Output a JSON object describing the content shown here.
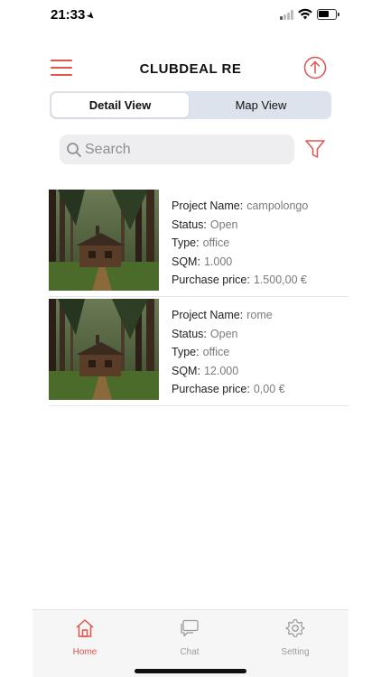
{
  "status_bar": {
    "time": "21:33",
    "location_icon": "location-arrow-icon"
  },
  "header": {
    "title": "CLUBDEAL RE",
    "menu_icon": "hamburger-menu-icon",
    "action_icon": "upload-icon"
  },
  "view_toggle": {
    "options": [
      "Detail View",
      "Map View"
    ],
    "selected": "Detail View"
  },
  "search": {
    "placeholder": "Search",
    "value": ""
  },
  "colors": {
    "accent": "#e4534b",
    "segmented_bg": "#dde3ec",
    "search_bg": "#eeeef0",
    "tab_inactive": "#9b9b9b"
  },
  "projects": [
    {
      "name_label": "Project Name:",
      "name": "campolongo",
      "status_label": "Status:",
      "status": "Open",
      "type_label": "Type:",
      "type": "office",
      "sqm_label": "SQM:",
      "sqm": "1.000",
      "price_label": "Purchase price:",
      "price": "1.500,00 €"
    },
    {
      "name_label": "Project Name:",
      "name": "rome",
      "status_label": "Status:",
      "status": "Open",
      "type_label": "Type:",
      "type": "office",
      "sqm_label": "SQM:",
      "sqm": "12.000",
      "price_label": "Purchase price:",
      "price": "0,00 €"
    }
  ],
  "tab_bar": [
    {
      "label": "Home",
      "icon": "home-icon",
      "active": true
    },
    {
      "label": "Chat",
      "icon": "chat-icon",
      "active": false
    },
    {
      "label": "Setting",
      "icon": "gear-icon",
      "active": false
    }
  ]
}
